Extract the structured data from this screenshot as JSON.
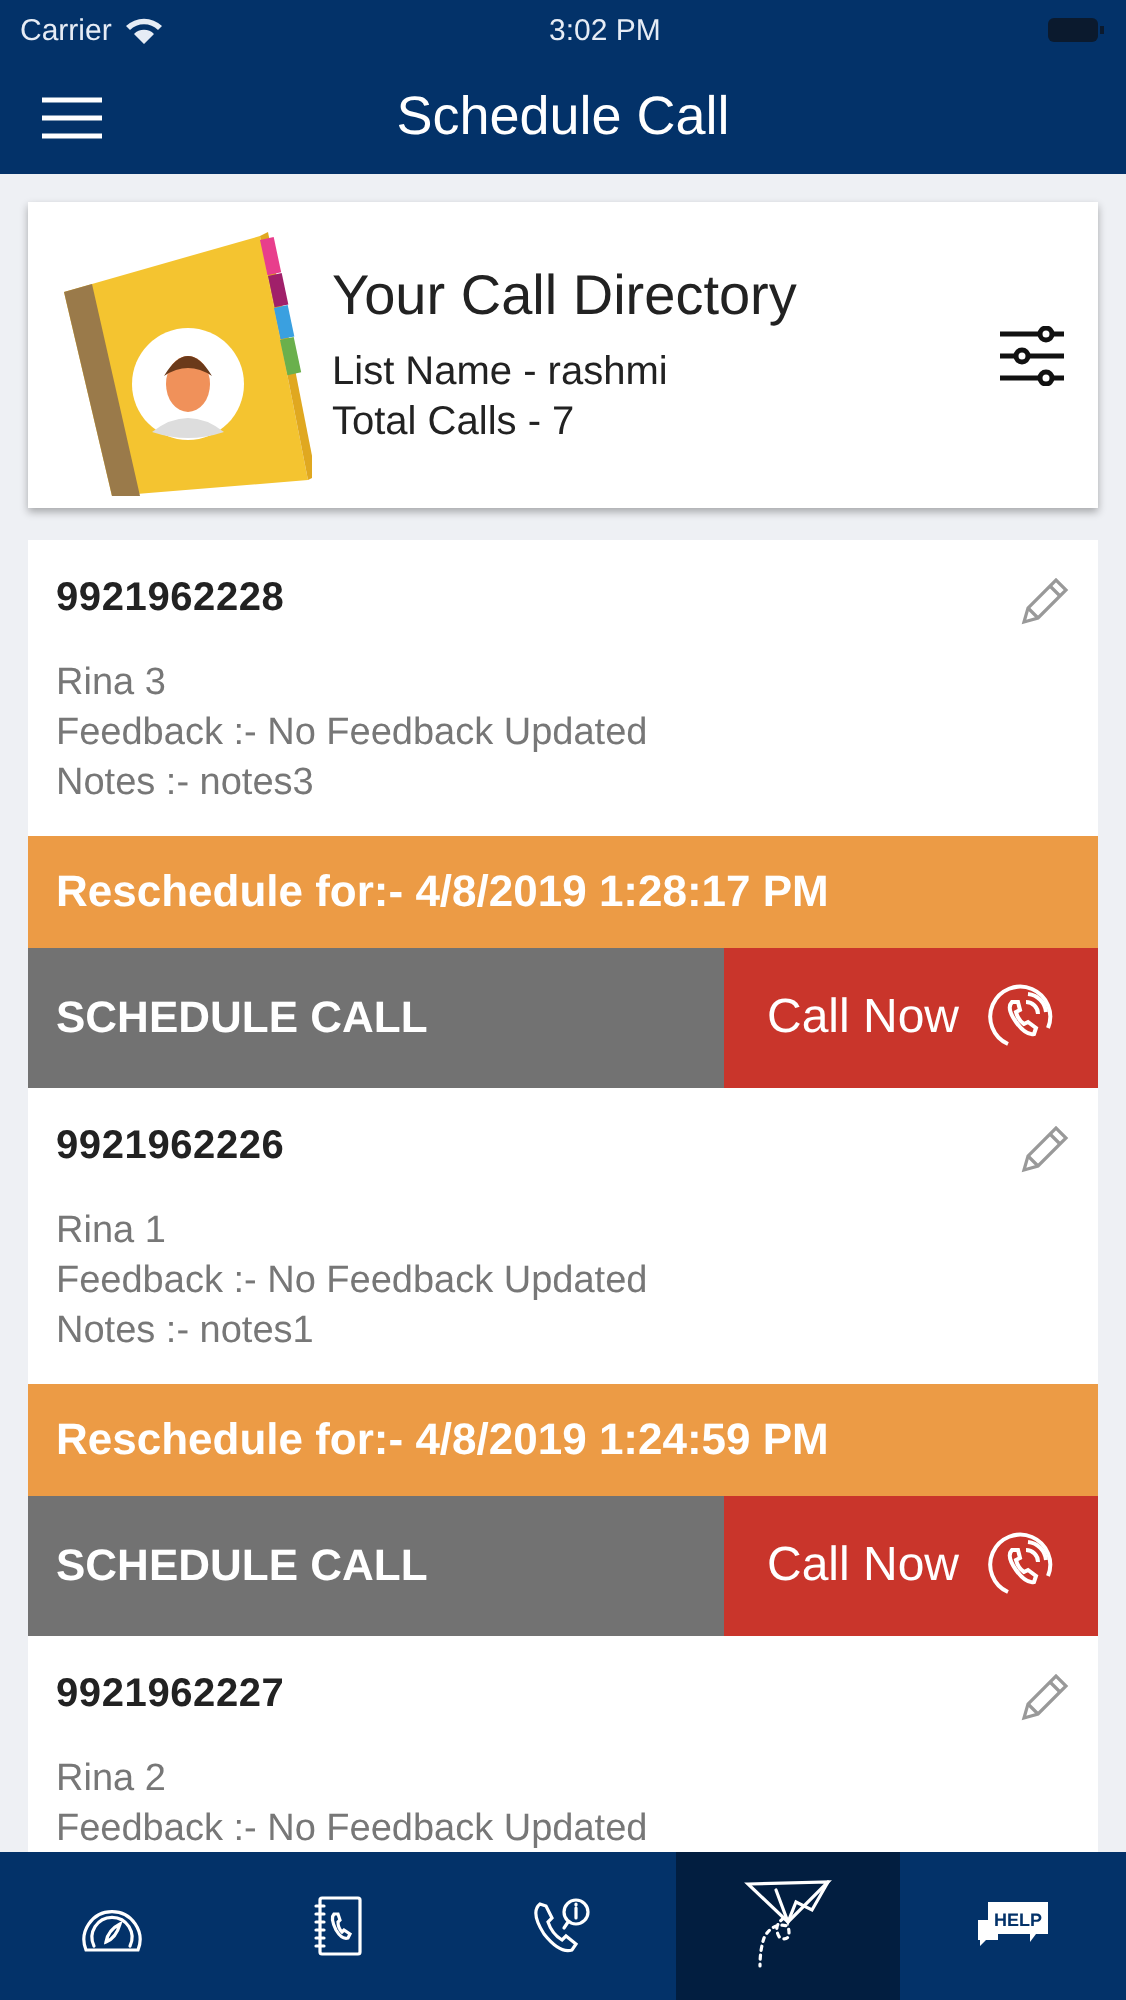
{
  "status_bar": {
    "carrier": "Carrier",
    "time": "3:02 PM"
  },
  "header": {
    "title": "Schedule Call"
  },
  "directory": {
    "title": "Your Call Directory",
    "list_name": "List Name - rashmi",
    "total": "Total Calls - 7"
  },
  "calls": [
    {
      "number": "9921962228",
      "name": "Rina 3",
      "feedback": "Feedback :- No Feedback Updated",
      "notes": "Notes :- notes3",
      "reschedule": "Reschedule for:- 4/8/2019 1:28:17 PM",
      "schedule_label": "SCHEDULE CALL",
      "call_label": "Call Now"
    },
    {
      "number": "9921962226",
      "name": "Rina 1",
      "feedback": "Feedback :- No Feedback Updated",
      "notes": "Notes :- notes1",
      "reschedule": "Reschedule for:- 4/8/2019 1:24:59 PM",
      "schedule_label": "SCHEDULE CALL",
      "call_label": "Call Now"
    },
    {
      "number": "9921962227",
      "name": "Rina 2",
      "feedback": "Feedback :- No Feedback Updated"
    }
  ],
  "nav": [
    {
      "kind": "gauge",
      "selected": false
    },
    {
      "kind": "contacts",
      "selected": false
    },
    {
      "kind": "call-info",
      "selected": false
    },
    {
      "kind": "plane",
      "selected": true
    },
    {
      "kind": "help",
      "selected": false,
      "label": "HELP"
    }
  ]
}
